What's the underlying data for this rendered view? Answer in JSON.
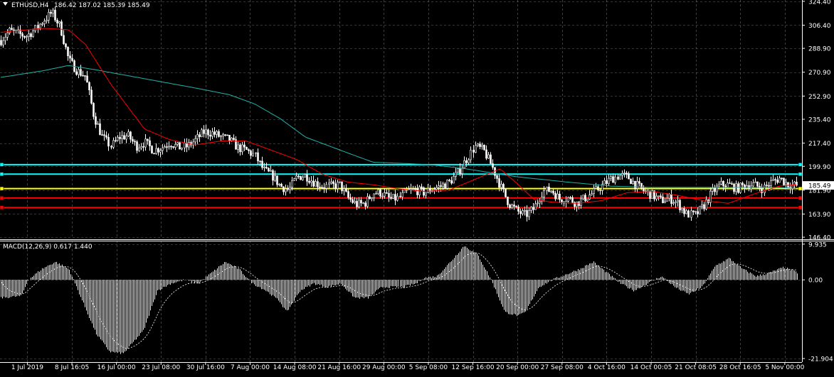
{
  "header": {
    "symbol": "ETHUSD,H4",
    "ohlc": "186.42 187.02 185.39 185.49"
  },
  "macd": {
    "label": "MACD(12,26,9) 0.617 1.440"
  },
  "colors": {
    "background": "#000000",
    "grid": "#c0c0c0",
    "candle": "#ffffff",
    "ma_fast": "#ff0000",
    "ma_slow": "#20b2aa",
    "level_cyan": "#00ffff",
    "level_yellow": "#ffff00",
    "level_red": "#ff0000",
    "price_tag": "#ffffff"
  },
  "chart_data": [
    {
      "type": "candlestick",
      "title": "ETHUSD,H4",
      "price_ticks": [
        "324.40",
        "306.40",
        "288.90",
        "270.90",
        "252.90",
        "235.40",
        "217.40",
        "199.90",
        "181.90",
        "163.90",
        "146.40"
      ],
      "price_ticks_values": [
        324.4,
        306.4,
        288.9,
        270.9,
        252.9,
        235.4,
        217.4,
        199.9,
        181.9,
        163.9,
        146.4
      ],
      "ylim": [
        145.4,
        325.4
      ],
      "current_price": "185.49",
      "current_price_value": 185.49,
      "x_tick_labels": [
        "1 Jul 2019",
        "8 Jul 16:05",
        "16 Jul 00:00",
        "23 Jul 08:00",
        "30 Jul 16:00",
        "7 Aug 00:00",
        "14 Aug 08:00",
        "21 Aug 16:00",
        "29 Aug 00:00",
        "5 Sep 08:00",
        "12 Sep 16:00",
        "20 Sep 00:00",
        "27 Sep 08:00",
        "4 Oct 16:00",
        "14 Oct 00:05",
        "21 Oct 08:05",
        "28 Oct 16:05",
        "5 Nov 00:00"
      ],
      "close_path": [
        [
          0,
          295
        ],
        [
          1,
          302
        ],
        [
          2,
          300
        ],
        [
          3,
          298
        ],
        [
          4,
          303
        ],
        [
          5,
          310
        ],
        [
          6,
          316
        ],
        [
          7,
          305
        ],
        [
          8,
          280
        ],
        [
          9,
          272
        ],
        [
          10,
          268
        ],
        [
          11,
          238
        ],
        [
          12,
          222
        ],
        [
          13,
          215
        ],
        [
          14,
          222
        ],
        [
          15,
          223
        ],
        [
          16,
          215
        ],
        [
          17,
          218
        ],
        [
          18,
          212
        ],
        [
          19,
          214
        ],
        [
          20,
          218
        ],
        [
          21,
          214
        ],
        [
          22,
          215
        ],
        [
          23,
          220
        ],
        [
          24,
          226
        ],
        [
          25,
          225
        ],
        [
          26,
          222
        ],
        [
          27,
          220
        ],
        [
          28,
          214
        ],
        [
          29,
          212
        ],
        [
          30,
          208
        ],
        [
          31,
          197
        ],
        [
          32,
          193
        ],
        [
          33,
          185
        ],
        [
          34,
          182
        ],
        [
          35,
          192
        ],
        [
          36,
          193
        ],
        [
          37,
          188
        ],
        [
          38,
          185
        ],
        [
          39,
          185
        ],
        [
          40,
          186
        ],
        [
          41,
          176
        ],
        [
          42,
          171
        ],
        [
          43,
          172
        ],
        [
          44,
          180
        ],
        [
          45,
          180
        ],
        [
          46,
          175
        ],
        [
          47,
          176
        ],
        [
          48,
          181
        ],
        [
          49,
          182
        ],
        [
          50,
          180
        ],
        [
          51,
          183
        ],
        [
          52,
          185
        ],
        [
          53,
          188
        ],
        [
          54,
          195
        ],
        [
          55,
          205
        ],
        [
          56,
          215
        ],
        [
          57,
          212
        ],
        [
          58,
          200
        ],
        [
          59,
          185
        ],
        [
          60,
          172
        ],
        [
          61,
          166
        ],
        [
          62,
          163
        ],
        [
          63,
          168
        ],
        [
          64,
          181
        ],
        [
          65,
          182
        ],
        [
          66,
          175
        ],
        [
          67,
          176
        ],
        [
          68,
          172
        ],
        [
          69,
          176
        ],
        [
          70,
          180
        ],
        [
          71,
          185
        ],
        [
          72,
          190
        ],
        [
          73,
          193
        ],
        [
          74,
          192
        ],
        [
          75,
          186
        ],
        [
          76,
          181
        ],
        [
          77,
          178
        ],
        [
          78,
          174
        ],
        [
          79,
          176
        ],
        [
          80,
          172
        ],
        [
          81,
          164
        ],
        [
          82,
          163
        ],
        [
          83,
          170
        ],
        [
          84,
          180
        ],
        [
          85,
          186
        ],
        [
          86,
          186
        ],
        [
          87,
          183
        ],
        [
          88,
          186
        ],
        [
          89,
          186
        ],
        [
          90,
          183
        ],
        [
          91,
          188
        ],
        [
          92,
          191
        ],
        [
          93,
          186
        ],
        [
          94,
          185.49
        ]
      ],
      "ma_fast_path": [
        [
          0,
          301
        ],
        [
          5,
          304
        ],
        [
          8,
          303
        ],
        [
          10,
          292
        ],
        [
          13,
          262
        ],
        [
          17,
          228
        ],
        [
          20,
          220
        ],
        [
          23,
          216
        ],
        [
          26,
          219
        ],
        [
          29,
          219
        ],
        [
          32,
          212
        ],
        [
          35,
          205
        ],
        [
          38,
          194
        ],
        [
          41,
          188
        ],
        [
          44,
          186
        ],
        [
          47,
          183
        ],
        [
          50,
          181
        ],
        [
          53,
          182
        ],
        [
          56,
          190
        ],
        [
          59,
          198
        ],
        [
          61,
          187
        ],
        [
          63,
          175
        ],
        [
          65,
          173
        ],
        [
          68,
          172
        ],
        [
          71,
          174
        ],
        [
          74,
          180
        ],
        [
          77,
          181
        ],
        [
          80,
          178
        ],
        [
          83,
          174
        ],
        [
          86,
          172
        ],
        [
          89,
          179
        ],
        [
          92,
          185
        ],
        [
          94,
          186
        ]
      ],
      "ma_slow_path": [
        [
          0,
          267
        ],
        [
          5,
          272
        ],
        [
          8,
          276
        ],
        [
          11,
          273
        ],
        [
          17,
          266
        ],
        [
          23,
          259
        ],
        [
          27,
          254
        ],
        [
          30,
          247
        ],
        [
          33,
          236
        ],
        [
          36,
          222
        ],
        [
          41,
          210
        ],
        [
          44,
          203
        ],
        [
          48,
          202
        ],
        [
          51,
          201
        ],
        [
          55,
          198
        ],
        [
          61,
          192
        ],
        [
          67,
          188
        ],
        [
          72,
          185
        ],
        [
          77,
          184
        ],
        [
          83,
          184
        ],
        [
          88,
          184
        ],
        [
          92,
          184
        ],
        [
          94,
          183
        ]
      ],
      "levels": [
        {
          "value": 201.2,
          "color": "#00ffff"
        },
        {
          "value": 194.0,
          "color": "#00ffff"
        },
        {
          "value": 183.1,
          "color": "#ffff00"
        },
        {
          "value": 176.0,
          "color": "#ff0000"
        },
        {
          "value": 168.8,
          "color": "#ff0000"
        }
      ]
    },
    {
      "type": "macd",
      "title": "MACD(12,26,9) 0.617 1.440",
      "macd_value": 0.617,
      "signal_value": 1.44,
      "y_tick_labels": [
        "9.935",
        "0.00",
        "-21.904"
      ],
      "y_tick_values": [
        9.935,
        0.0,
        -21.904
      ],
      "ylim": [
        -22.9,
        10.9
      ],
      "histogram_path": [
        [
          0,
          -5
        ],
        [
          3,
          -4.5
        ],
        [
          4,
          0
        ],
        [
          6,
          3
        ],
        [
          8,
          5
        ],
        [
          10,
          3
        ],
        [
          12,
          -6
        ],
        [
          14,
          -15
        ],
        [
          16,
          -20
        ],
        [
          18,
          -20.5
        ],
        [
          21,
          -14
        ],
        [
          23,
          -3
        ],
        [
          25,
          -1
        ],
        [
          27,
          0
        ],
        [
          29,
          -1
        ],
        [
          31,
          2
        ],
        [
          33,
          5
        ],
        [
          35,
          3
        ],
        [
          37,
          -1
        ],
        [
          39,
          -3
        ],
        [
          41,
          -6
        ],
        [
          42,
          -9
        ],
        [
          44,
          -3
        ],
        [
          46,
          -1
        ],
        [
          48,
          -2
        ],
        [
          50,
          -1
        ],
        [
          52,
          -5
        ],
        [
          54,
          -5
        ],
        [
          56,
          -2
        ],
        [
          59,
          -2
        ],
        [
          61,
          -1
        ],
        [
          62,
          0.5
        ],
        [
          64,
          1
        ],
        [
          66,
          5
        ],
        [
          68,
          9.5
        ],
        [
          70,
          7
        ],
        [
          72,
          0
        ],
        [
          74,
          -9
        ],
        [
          76,
          -10
        ],
        [
          77,
          -9
        ],
        [
          79,
          -2
        ],
        [
          81,
          0
        ],
        [
          83,
          1.5
        ],
        [
          85,
          3
        ],
        [
          87,
          5
        ],
        [
          89,
          2
        ],
        [
          91,
          -1
        ],
        [
          93,
          -3
        ],
        [
          95,
          -1
        ],
        [
          97,
          1
        ],
        [
          99,
          -2
        ],
        [
          101,
          -4
        ],
        [
          103,
          -2
        ],
        [
          105,
          4
        ],
        [
          107,
          6
        ],
        [
          109,
          3
        ],
        [
          111,
          1
        ],
        [
          113,
          2
        ],
        [
          115,
          3.5
        ],
        [
          117,
          2
        ]
      ]
    }
  ]
}
